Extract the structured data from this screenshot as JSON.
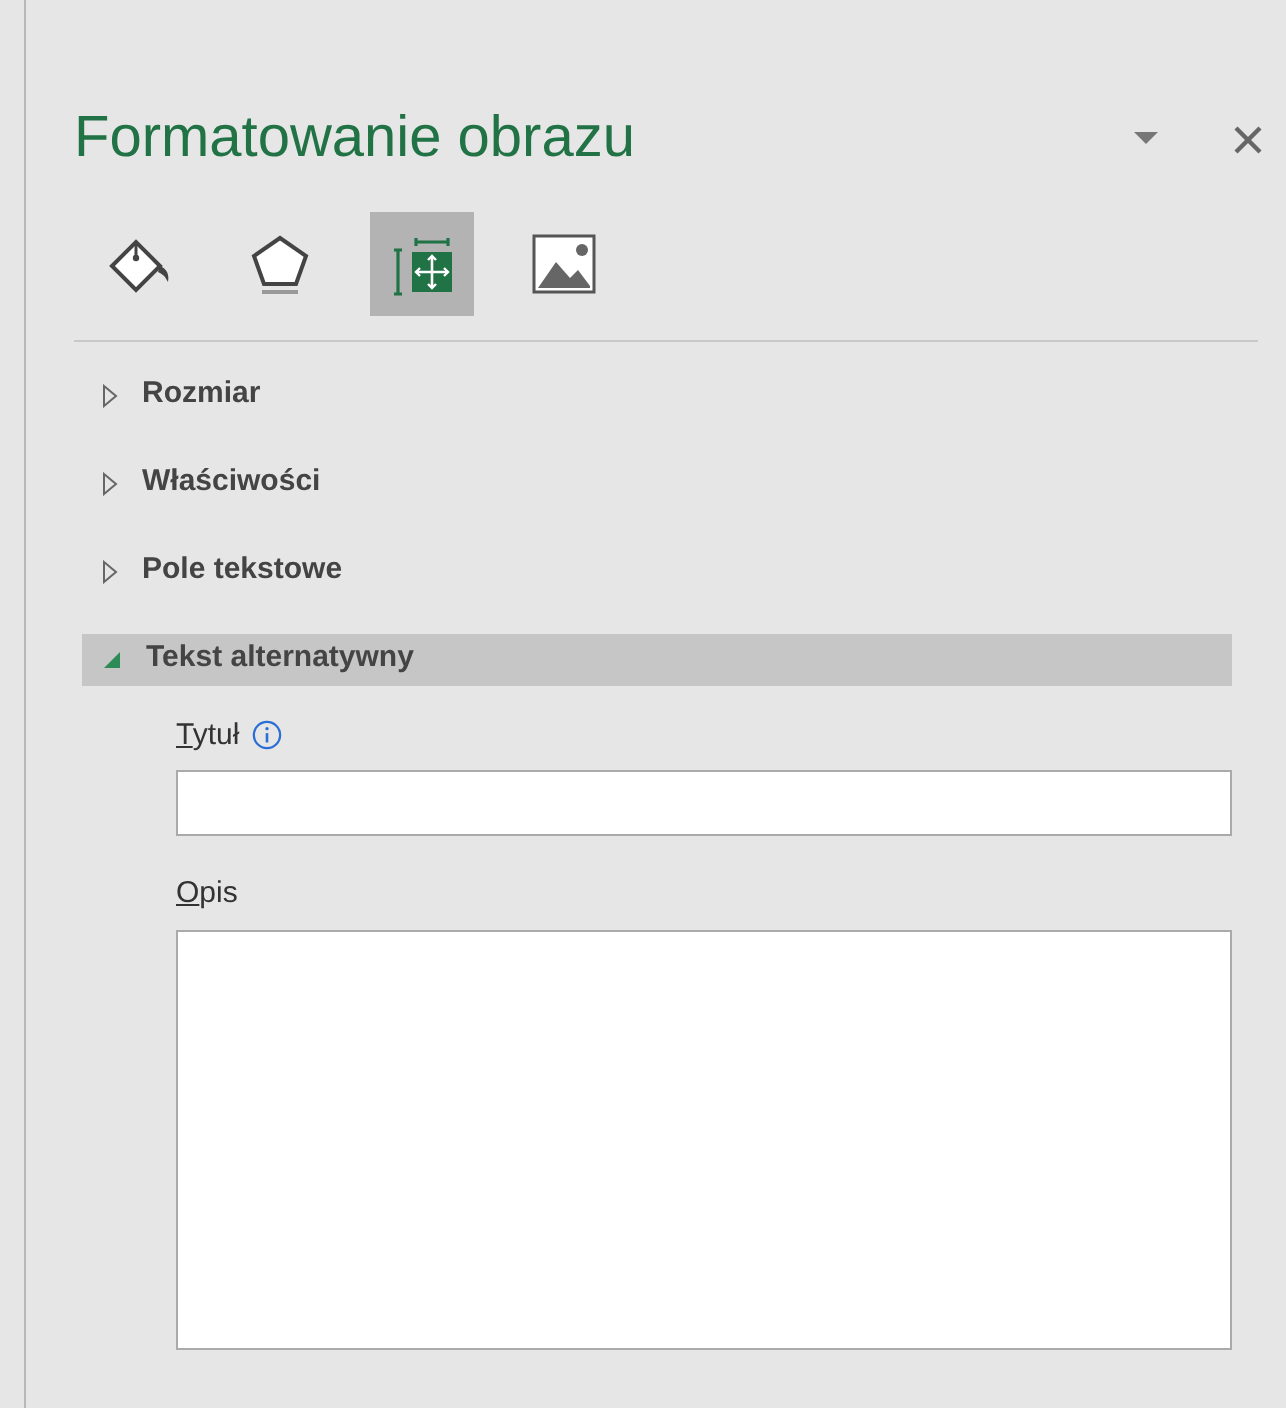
{
  "pane": {
    "title": "Formatowanie obrazu"
  },
  "tabs": [
    {
      "kind": "fill",
      "selected": false
    },
    {
      "kind": "shape",
      "selected": false
    },
    {
      "kind": "size",
      "selected": true
    },
    {
      "kind": "picture",
      "selected": false
    }
  ],
  "sections": [
    {
      "label": "Rozmiar",
      "expanded": false
    },
    {
      "label": "Właściwości",
      "expanded": false
    },
    {
      "label": "Pole tekstowe",
      "expanded": false
    },
    {
      "label": "Tekst alternatywny",
      "expanded": true
    }
  ],
  "fields": [
    {
      "label": "Tytuł",
      "mnemonic": true,
      "info": true,
      "kind": "single"
    },
    {
      "label": "Opis",
      "mnemonic": true,
      "info": false,
      "kind": "multi"
    }
  ]
}
